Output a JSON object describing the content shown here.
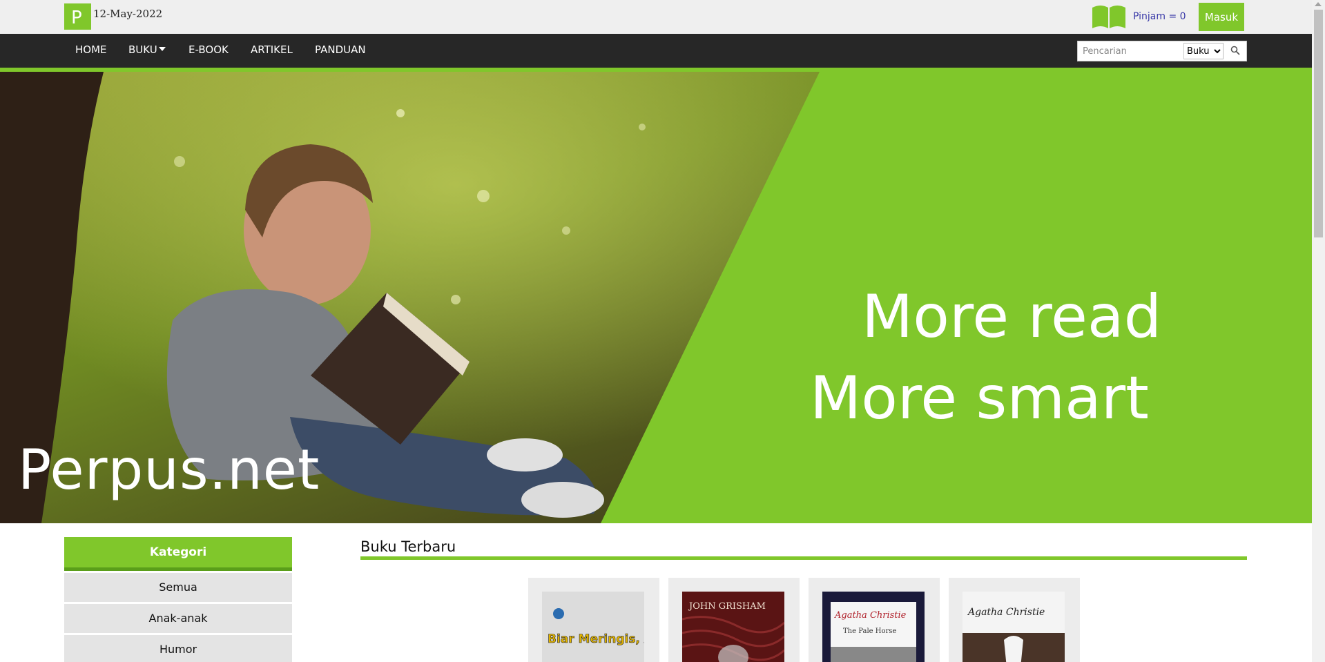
{
  "header": {
    "logo_letter": "P",
    "date": "12-May-2022",
    "cart_icon": "book-icon",
    "pinjam_label": "Pinjam = 0",
    "login_label": "Masuk"
  },
  "nav": {
    "items": [
      {
        "label": "HOME"
      },
      {
        "label": "BUKU"
      },
      {
        "label": "E-BOOK"
      },
      {
        "label": "ARTIKEL"
      },
      {
        "label": "PANDUAN"
      }
    ],
    "search": {
      "placeholder": "Pencarian",
      "select_value": "Buku",
      "button_icon": "search-icon"
    }
  },
  "hero": {
    "brand": "Perpus.net",
    "line1": "More read",
    "line2": "More smart"
  },
  "sidebar": {
    "title": "Kategori",
    "items": [
      "Semua",
      "Anak-anak",
      "Humor"
    ]
  },
  "main": {
    "section_title": "Buku Terbaru",
    "books": [
      {
        "cover_text": "Biar Meringis, Asal Laris"
      },
      {
        "cover_text": "JOHN GRISHAM"
      },
      {
        "cover_text": "Agatha Christie",
        "cover_subtitle": "The Pale Horse"
      },
      {
        "cover_text": "Agatha Christie"
      }
    ]
  },
  "colors": {
    "accent": "#80c72b",
    "nav_bg": "#272727",
    "topbar_bg": "#efefef"
  }
}
